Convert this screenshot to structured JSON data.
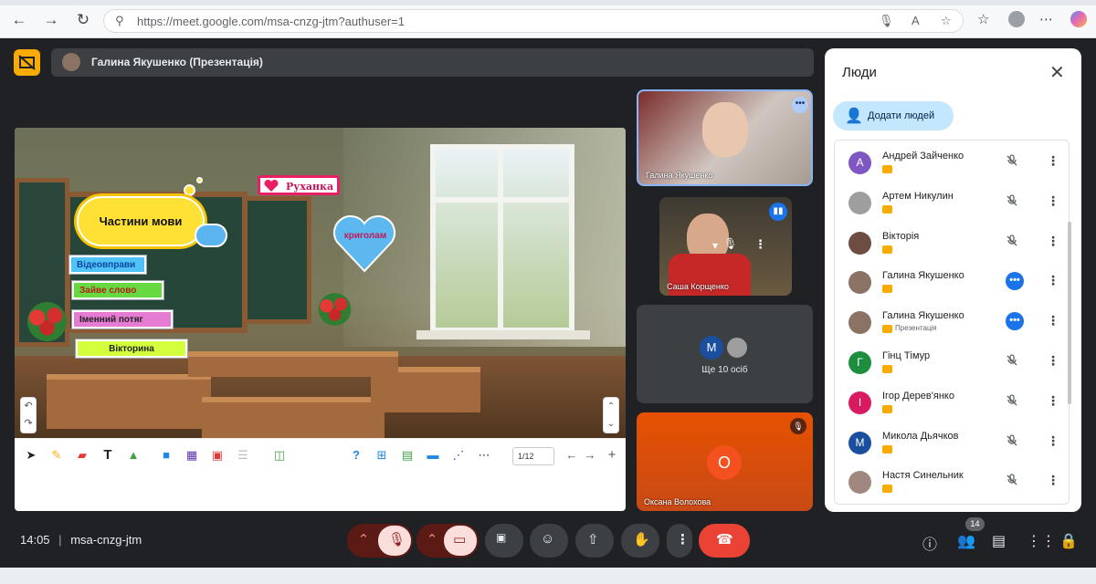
{
  "browser": {
    "url": "https://meet.google.com/msa-cnzg-jtm?authuser=1"
  },
  "presentation": {
    "title": "Галина Якушенко (Презентація)"
  },
  "slide": {
    "cloud_text": "Частини мови",
    "ruxanka": "Руханка",
    "heart_text": "криголам",
    "tags": [
      "Відеовправи",
      "Зайве слово",
      "Іменний потяг",
      "Вікторина"
    ],
    "page": "1/12"
  },
  "tiles": {
    "presenter_name": "Галина Якушенко",
    "student_name": "Саша Корщенко",
    "more_label": "Ще 10 осіб",
    "more_avatar": "М",
    "oksana_initial": "О",
    "oksana_name": "Оксана Волохова"
  },
  "people_panel": {
    "title": "Люди",
    "add_label": "Додати людей",
    "participants": [
      {
        "name": "Андрей Зайченко",
        "initial": "А",
        "color": "#7e57c2",
        "sub": "",
        "state": "muted"
      },
      {
        "name": "Артем Никулин",
        "initial": "",
        "color": "#9e9e9e",
        "sub": "",
        "state": "muted"
      },
      {
        "name": "Вікторія",
        "initial": "",
        "color": "#6d4c41",
        "sub": "",
        "state": "muted"
      },
      {
        "name": "Галина Якушенко",
        "initial": "",
        "color": "#8a7364",
        "sub": "",
        "state": "more"
      },
      {
        "name": "Галина Якушенко",
        "initial": "",
        "color": "#8a7364",
        "sub": "Презентація",
        "state": "more"
      },
      {
        "name": "Гінц Тімур",
        "initial": "Г",
        "color": "#1e8e3e",
        "sub": "",
        "state": "muted"
      },
      {
        "name": "Ігор Дерев'янко",
        "initial": "І",
        "color": "#d81b60",
        "sub": "",
        "state": "muted"
      },
      {
        "name": "Микола Дьячков",
        "initial": "М",
        "color": "#1a4fa0",
        "sub": "",
        "state": "muted"
      },
      {
        "name": "Настя Синельник",
        "initial": "",
        "color": "#a1887f",
        "sub": "",
        "state": "muted"
      }
    ]
  },
  "bottom": {
    "time": "14:05",
    "separator": "|",
    "meeting_code": "msa-cnzg-jtm",
    "participants_count": "14"
  },
  "colors": {
    "accent": "#f9ab00",
    "end_call": "#ea4335",
    "mic_off_bg": "#f9dedc"
  }
}
